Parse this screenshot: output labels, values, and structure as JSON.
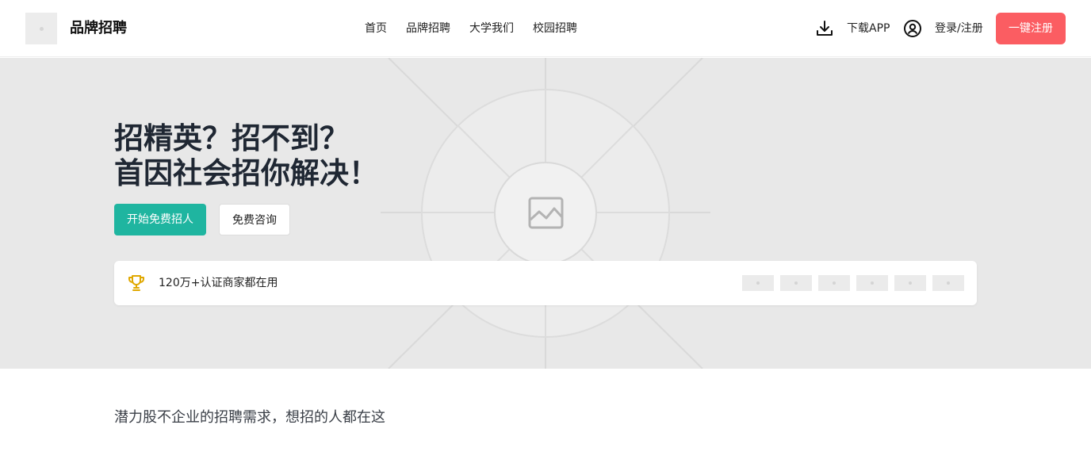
{
  "header": {
    "brand": "品牌招聘",
    "logo_icon": "image-placeholder-icon",
    "nav": [
      "首页",
      "品牌招聘",
      "大学我们",
      "校园招聘"
    ],
    "download_label": "下载APP",
    "login_label": "登录/注册",
    "register_button": "一键注册",
    "accent_color": "#fb5d62"
  },
  "hero": {
    "title_line1": "招精英？招不到？",
    "title_line2": "首因社会招你解决！",
    "primary_button": "开始免费招人",
    "secondary_button": "免费咨询",
    "primary_color": "#1fb5a0",
    "image_icon": "image-placeholder-icon",
    "trust": {
      "icon": "trophy-icon",
      "text": "120万+认证商家都在用",
      "partner_logos": [
        "partner-logo",
        "partner-logo",
        "partner-logo",
        "partner-logo",
        "partner-logo",
        "partner-logo"
      ]
    }
  },
  "section": {
    "title": "潜力股不企业的招聘需求，想招的人都在这"
  }
}
